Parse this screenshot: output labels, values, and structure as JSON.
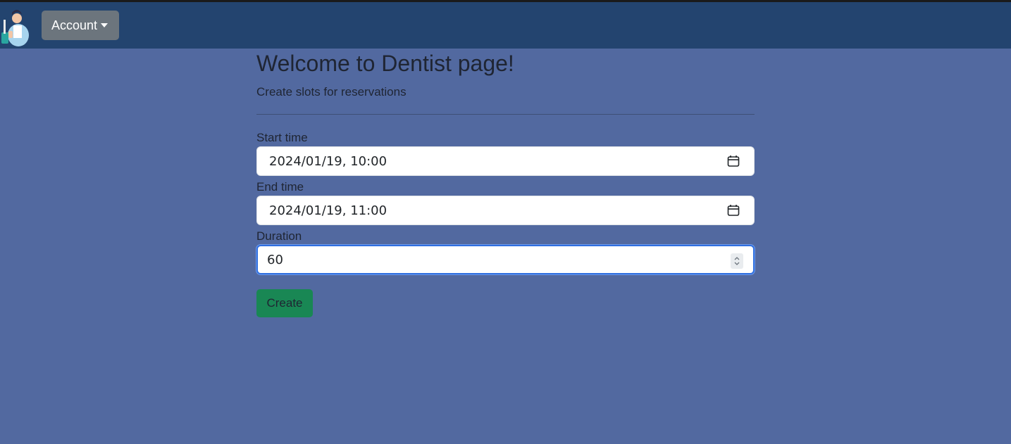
{
  "navbar": {
    "logo_icon": "dentist-logo-icon",
    "account_label": "Account",
    "account_icon": "caret-down-icon"
  },
  "page": {
    "title": "Welcome to Dentist page!",
    "subtitle": "Create slots for reservations"
  },
  "form": {
    "start_time": {
      "label": "Start time",
      "value": "2024/01/19, 10:00",
      "icon": "calendar-icon"
    },
    "end_time": {
      "label": "End time",
      "value": "2024/01/19, 11:00",
      "icon": "calendar-icon"
    },
    "duration": {
      "label": "Duration",
      "value": "60",
      "icon": "spinner-icon"
    },
    "create_label": "Create"
  },
  "colors": {
    "page_background": "#5269a0",
    "navbar_background": "#23446f",
    "account_button": "#6c757d",
    "create_button": "#198754",
    "focus_border": "#2f6fe0"
  }
}
